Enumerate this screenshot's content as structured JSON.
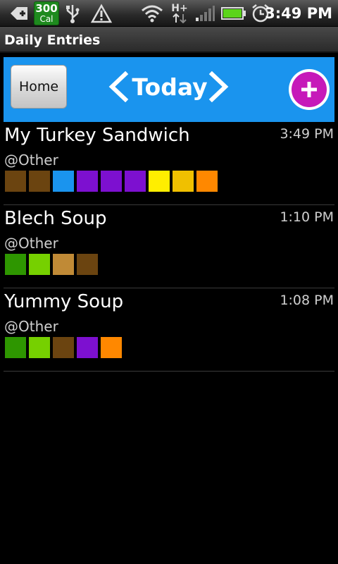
{
  "status_bar": {
    "calorie_count": "300",
    "calorie_unit": "Cal",
    "network_label": "H+",
    "time": "3:49 PM",
    "icons": [
      "add-notification-icon",
      "usb-icon",
      "warning-icon",
      "wifi-icon",
      "network-type-icon",
      "signal-icon",
      "battery-icon",
      "alarm-icon"
    ]
  },
  "title_bar": {
    "title": "Daily Entries"
  },
  "header": {
    "home_label": "Home",
    "date_label": "Today",
    "prev_icon": "chevron-left-icon",
    "next_icon": "chevron-right-icon",
    "add_icon": "plus-icon",
    "accent_color": "#1a94ee",
    "add_color": "#c619b9"
  },
  "entries": [
    {
      "name": "My Turkey Sandwich",
      "time": "3:49 PM",
      "category": "@Other",
      "colors": [
        "#6b4410",
        "#6b4410",
        "#1a94ee",
        "#7d10d0",
        "#7d10d0",
        "#7d10d0",
        "#ffee00",
        "#f0c000",
        "#ff8800"
      ]
    },
    {
      "name": "Blech Soup",
      "time": "1:10 PM",
      "category": "@Other",
      "colors": [
        "#2e9600",
        "#76d000",
        "#c08a36",
        "#6b4410"
      ]
    },
    {
      "name": "Yummy Soup",
      "time": "1:08 PM",
      "category": "@Other",
      "colors": [
        "#2e9600",
        "#76d000",
        "#6b4410",
        "#7d10d0",
        "#ff8800"
      ]
    }
  ]
}
